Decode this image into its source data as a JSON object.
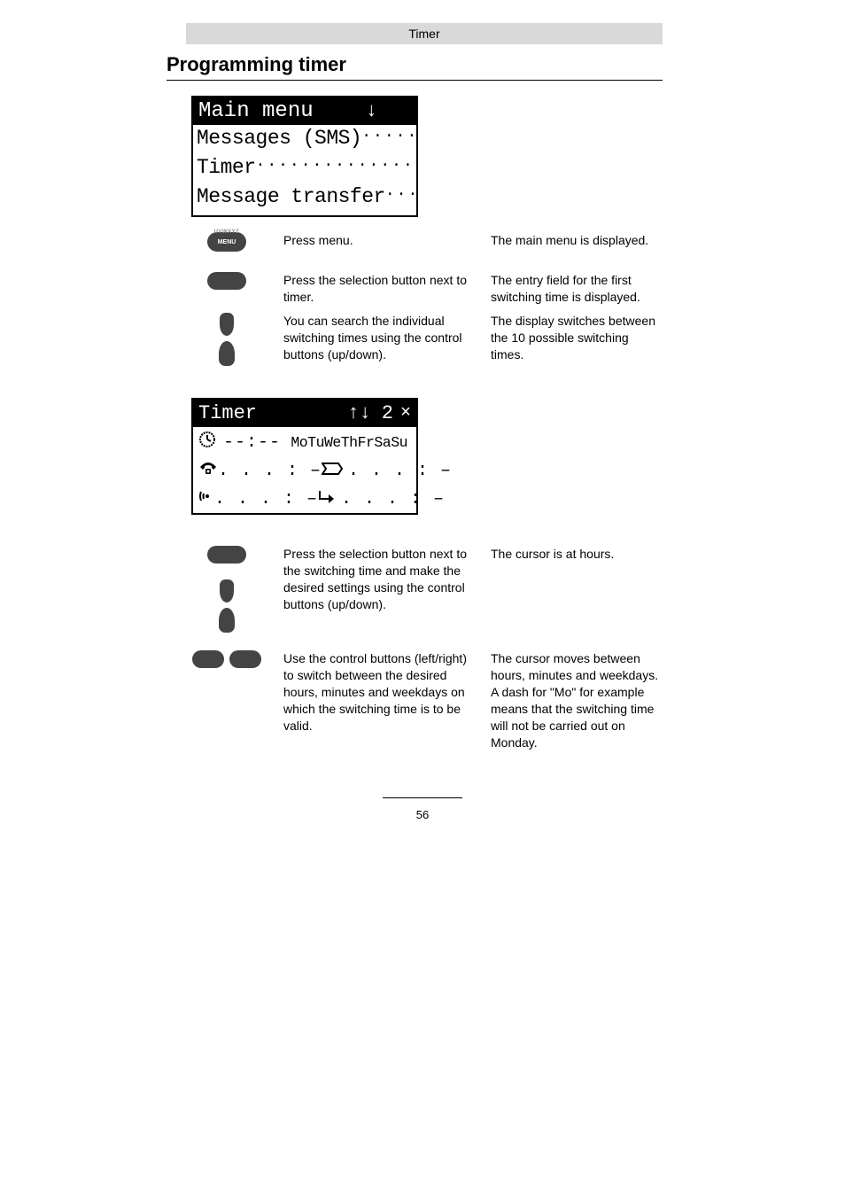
{
  "header": {
    "label": "Timer"
  },
  "section_title": "Programming timer",
  "lcd_main_menu": {
    "title": "Main menu",
    "items": [
      "Messages (SMS)",
      "Timer",
      "Message transfer"
    ]
  },
  "lcd_timer": {
    "title": "Timer",
    "nav_arrows": "↑↓",
    "counter_number": "2",
    "counter_x": "×",
    "row_time_value": "--:--",
    "row_time_days": "MoTuWeThFrSaSu",
    "val_dots": ". . . : –",
    "val_dots2": ". . . : –"
  },
  "buttons": {
    "menu_top": "UVWXYZ",
    "menu_label": "MENU"
  },
  "instructions": {
    "r1_left": "Press menu.",
    "r1_right": "The main menu is displayed.",
    "r2_left": "Press the selection button next to timer.",
    "r2_right": "The entry field for the first switching time is displayed.",
    "r3_left": "You can search the individual switching times using the control buttons (up/down).",
    "r3_right": "The display switches between the 10 possible switching times.",
    "r4_left": "Press the selection button next to the switching time and make the desired settings using the control buttons (up/down).",
    "r4_right": "The cursor is at hours.",
    "r5_left": "Use the control buttons (left/right) to switch between the desired hours, minutes and weekdays on which the switching time is to be valid.",
    "r5_right": "The cursor moves between hours, minutes and weekdays. A dash for \"Mo\" for example means that the switching time will not be carried out on Monday."
  },
  "page_number": "56"
}
